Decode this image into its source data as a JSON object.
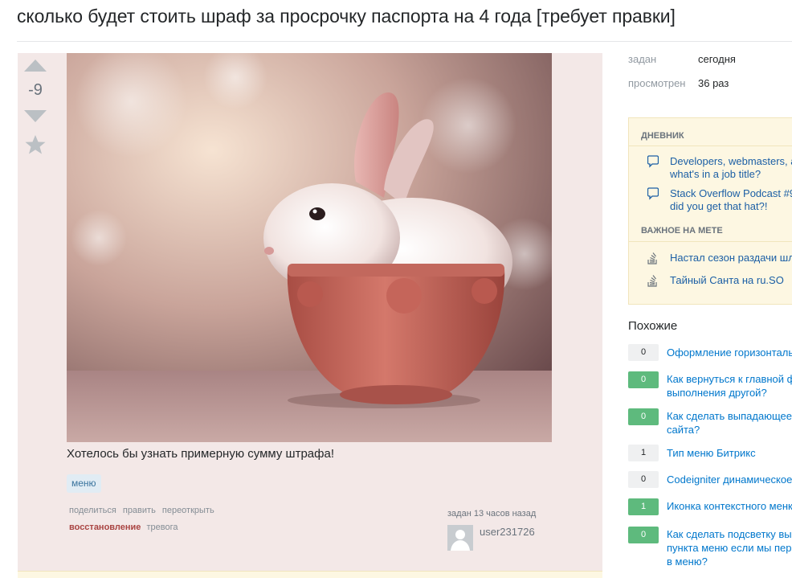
{
  "question": {
    "title": "сколько будет стоить шраф за просрочку паспорта на 4 года [требует правки]",
    "vote_count": "-9",
    "body_text": "Хотелось бы узнать примерную сумму штрафа!",
    "tags": [
      "меню"
    ],
    "image_alt": "bunny-in-cup-photo"
  },
  "post_menu": {
    "share": "поделиться",
    "edit": "править",
    "reopen": "переоткрыть",
    "restore": "восстановление",
    "alarm": "тревога"
  },
  "owner": {
    "asked_time": "задан 13 часов назад",
    "user_name": "user231726"
  },
  "meta": {
    "asked_label": "задан",
    "asked_value": "сегодня",
    "viewed_label": "просмотрен",
    "viewed_value": "36 раз"
  },
  "sidebar_widget": {
    "blog_heading": "ДНЕВНИК",
    "blog_items": [
      {
        "line1": "Developers, webmasters, a",
        "line2": "what's in a job title?"
      },
      {
        "line1": "Stack Overflow Podcast #9",
        "line2": "did you get that hat?!"
      }
    ],
    "meta_heading": "ВАЖНОЕ НА МЕТЕ",
    "meta_items": [
      "Настал сезон раздачи шл",
      "Тайный Санта на ru.SO"
    ]
  },
  "related": {
    "title": "Похожие",
    "items": [
      {
        "score": "0",
        "line1": "Оформление горизонталь",
        "line2": ""
      },
      {
        "score": "0",
        "line1": "Как вернуться к главной ф",
        "line2": "выполнения другой?"
      },
      {
        "score": "0",
        "line1": "Как сделать выпадающее",
        "line2": "сайта?"
      },
      {
        "score": "1",
        "line1": "Тип меню Битрикс",
        "line2": ""
      },
      {
        "score": "0",
        "line1": "Codeigniter динамическое",
        "line2": ""
      },
      {
        "score": "1",
        "line1": "Иконка контекстного менк",
        "line2": ""
      },
      {
        "score": "0",
        "line1": "Как сделать подсветку вы",
        "line2": "пункта меню если мы пере",
        "line3": "в меню?"
      }
    ]
  },
  "colors": {
    "post_bg": "#f3e8e7",
    "link": "#0077cc",
    "accepted_green": "#5eba7d",
    "widget_bg": "#fdf7e2",
    "restore_red": "#a94442"
  }
}
